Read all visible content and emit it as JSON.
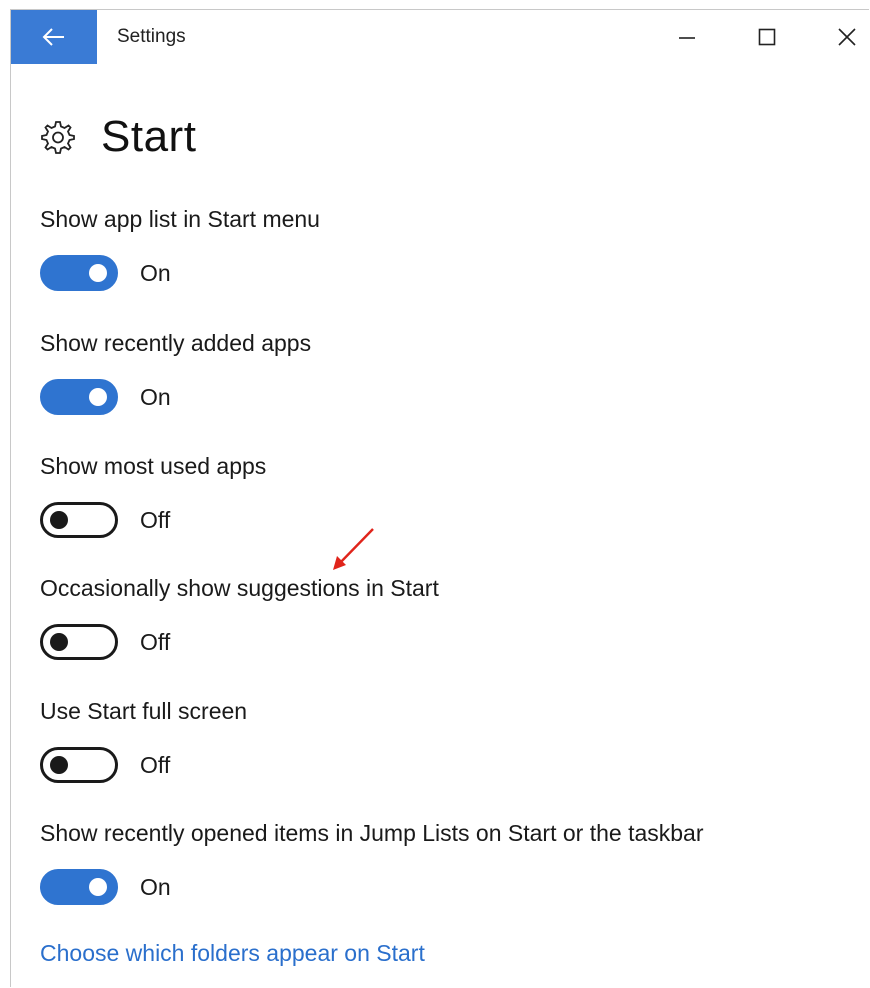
{
  "window": {
    "title": "Settings",
    "back_icon": "back-arrow-icon",
    "controls": [
      "minimize-icon",
      "maximize-icon",
      "close-icon"
    ]
  },
  "page": {
    "icon": "gear-icon",
    "title": "Start"
  },
  "settings": [
    {
      "label": "Show app list in Start menu",
      "state": "On"
    },
    {
      "label": "Show recently added apps",
      "state": "On"
    },
    {
      "label": "Show most used apps",
      "state": "Off"
    },
    {
      "label": "Occasionally show suggestions in Start",
      "state": "Off"
    },
    {
      "label": "Use Start full screen",
      "state": "Off"
    },
    {
      "label": "Show recently opened items in Jump Lists on Start or the taskbar",
      "state": "On"
    }
  ],
  "annotation": {
    "icon": "red-arrow-icon",
    "color": "#e0241b"
  },
  "link": {
    "label": "Choose which folders appear on Start"
  },
  "colors": {
    "accent": "#3a7bd5",
    "toggle_on": "#2f74d0",
    "link": "#2a6fcc"
  }
}
